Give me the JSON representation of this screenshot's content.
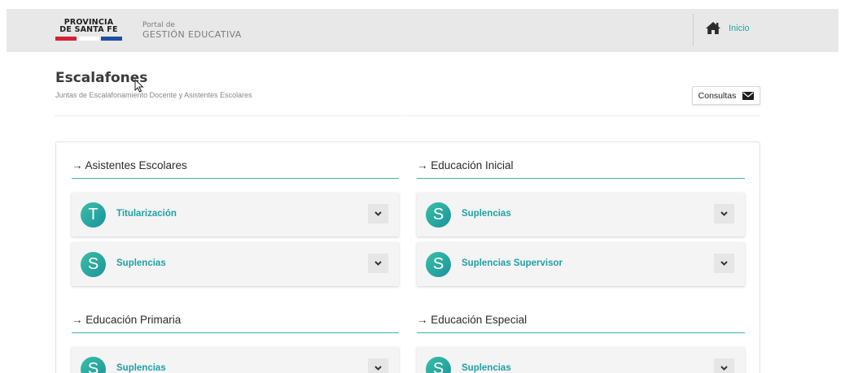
{
  "header": {
    "logo_line1": "PROVINCIA",
    "logo_line2": "DE SANTA FE",
    "flag_colors": [
      "#d42230",
      "#ffffff",
      "#1d4fa3"
    ],
    "portal_line1": "Portal de",
    "portal_line2": "GESTIÓN EDUCATIVA",
    "home_icon": "home-icon",
    "home_label": "Inicio"
  },
  "page": {
    "title": "Escalafones",
    "subtitle": "Juntas de Escalafonamiento Docente y Asistentes Escolares",
    "consultas_label": "Consultas",
    "consultas_icon": "envelope-icon"
  },
  "colors": {
    "accent": "#20a7a6",
    "header_bg": "#e8e8e8",
    "avatar_gradient": [
      "#3bbfa7",
      "#1e8fa0"
    ]
  },
  "sections": [
    {
      "heading": "→ Asistentes Escolares",
      "items": [
        {
          "letter": "T",
          "label": "Titularización"
        },
        {
          "letter": "S",
          "label": "Suplencias"
        }
      ]
    },
    {
      "heading": "→ Educación Inicial",
      "items": [
        {
          "letter": "S",
          "label": "Suplencias"
        },
        {
          "letter": "S",
          "label": "Suplencias Supervisor"
        }
      ]
    },
    {
      "heading": "→ Educación Primaria",
      "items": [
        {
          "letter": "S",
          "label": "Suplencias"
        }
      ]
    },
    {
      "heading": "→ Educación Especial",
      "items": [
        {
          "letter": "S",
          "label": "Suplencias"
        }
      ]
    }
  ]
}
